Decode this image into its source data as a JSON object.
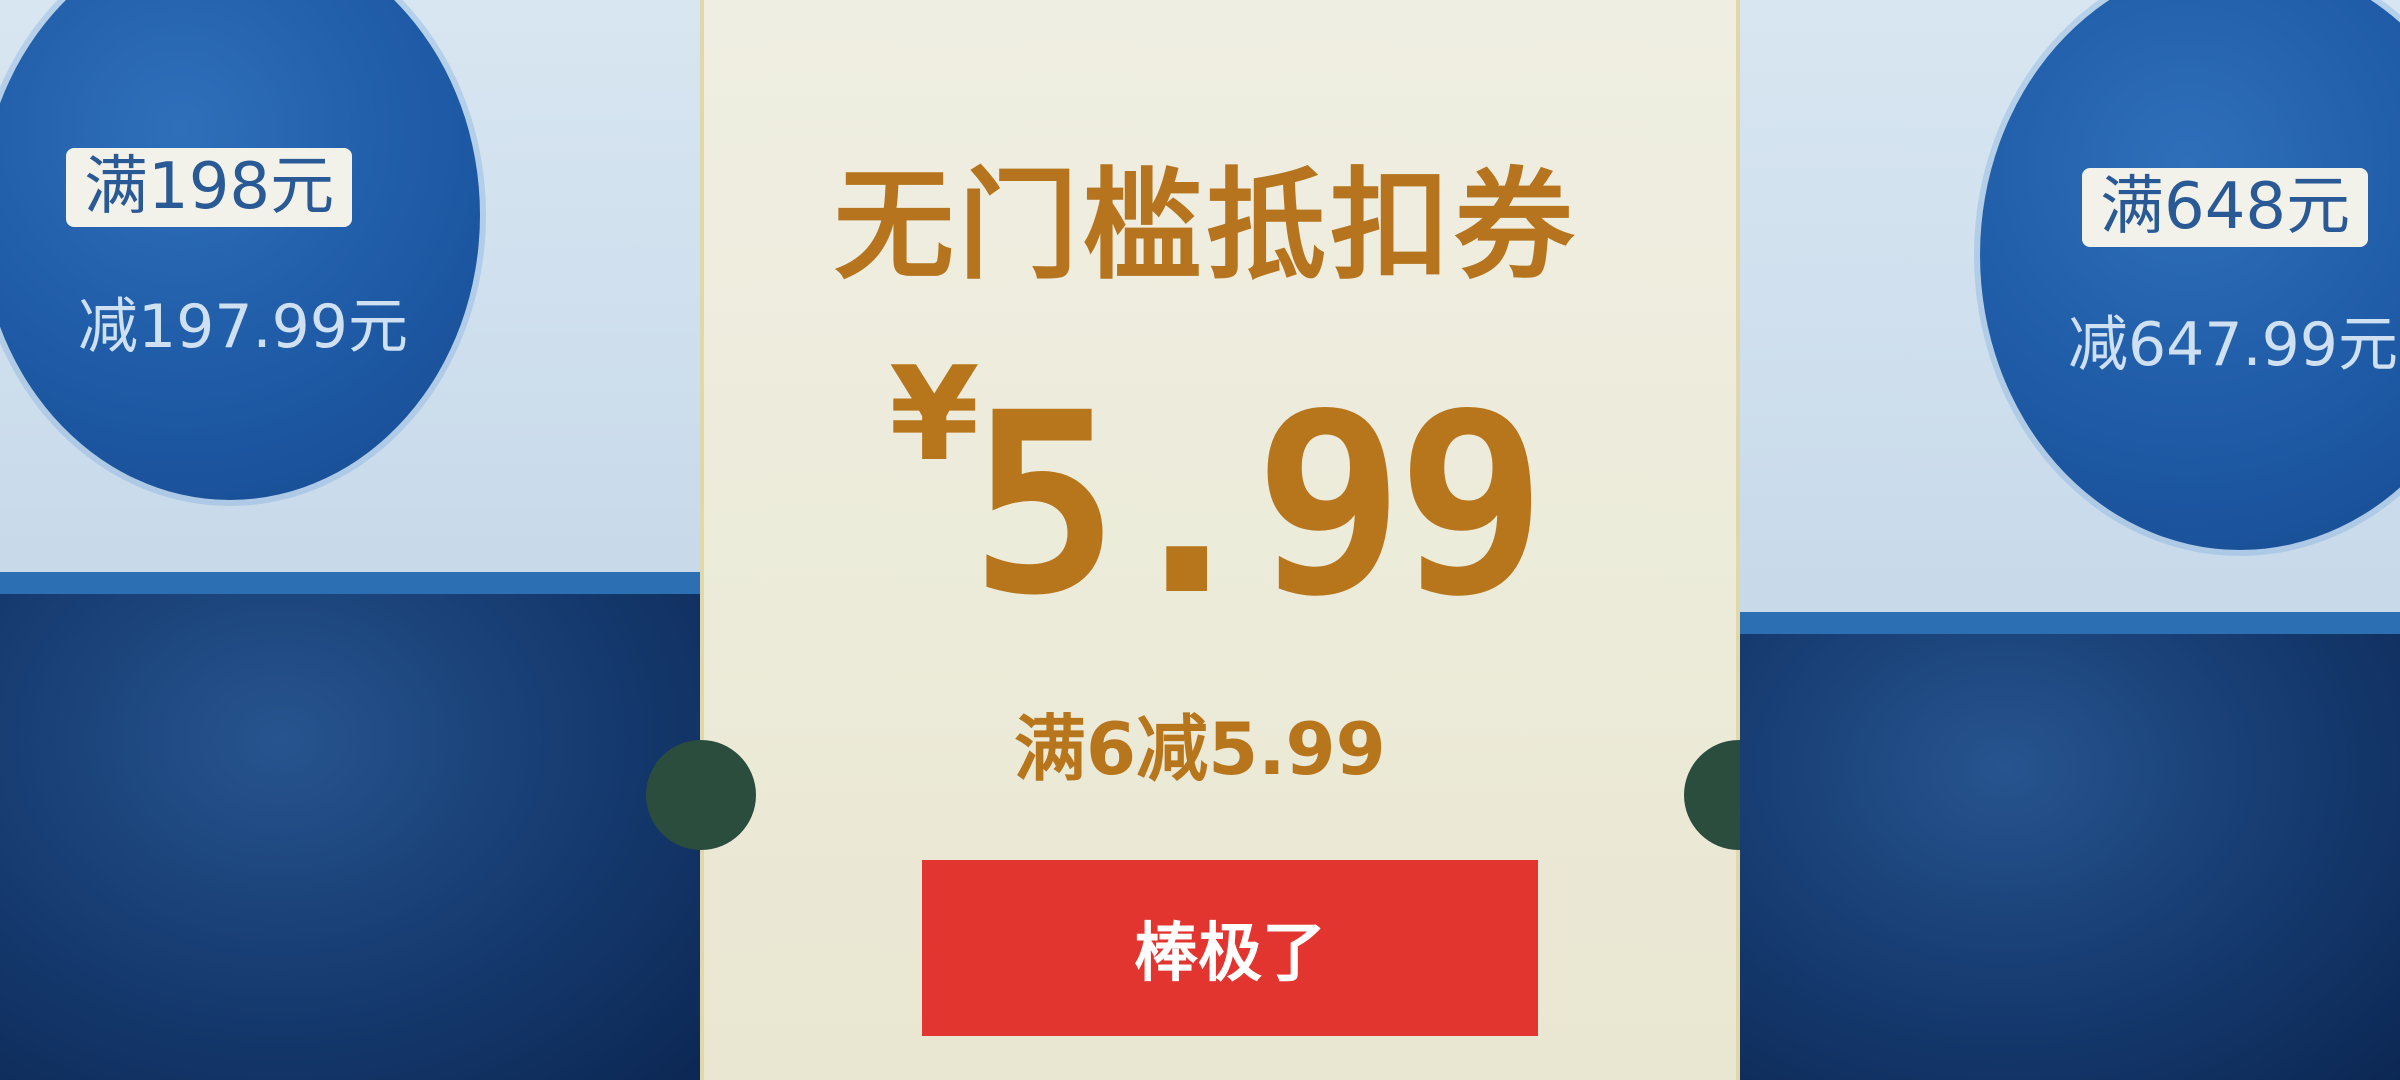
{
  "coupons": {
    "left": {
      "threshold": "满198元",
      "discount": "减197.99元"
    },
    "center": {
      "title": "无门槛抵扣券",
      "currency": "¥",
      "amount": "5.99",
      "condition": "满6减5.99",
      "button_label": "棒极了"
    },
    "right": {
      "threshold": "满648元",
      "discount": "减647.99元"
    }
  },
  "colors": {
    "accent": "#b7751c",
    "button": "#e2352f",
    "side_blue": "#1e5aa6"
  }
}
